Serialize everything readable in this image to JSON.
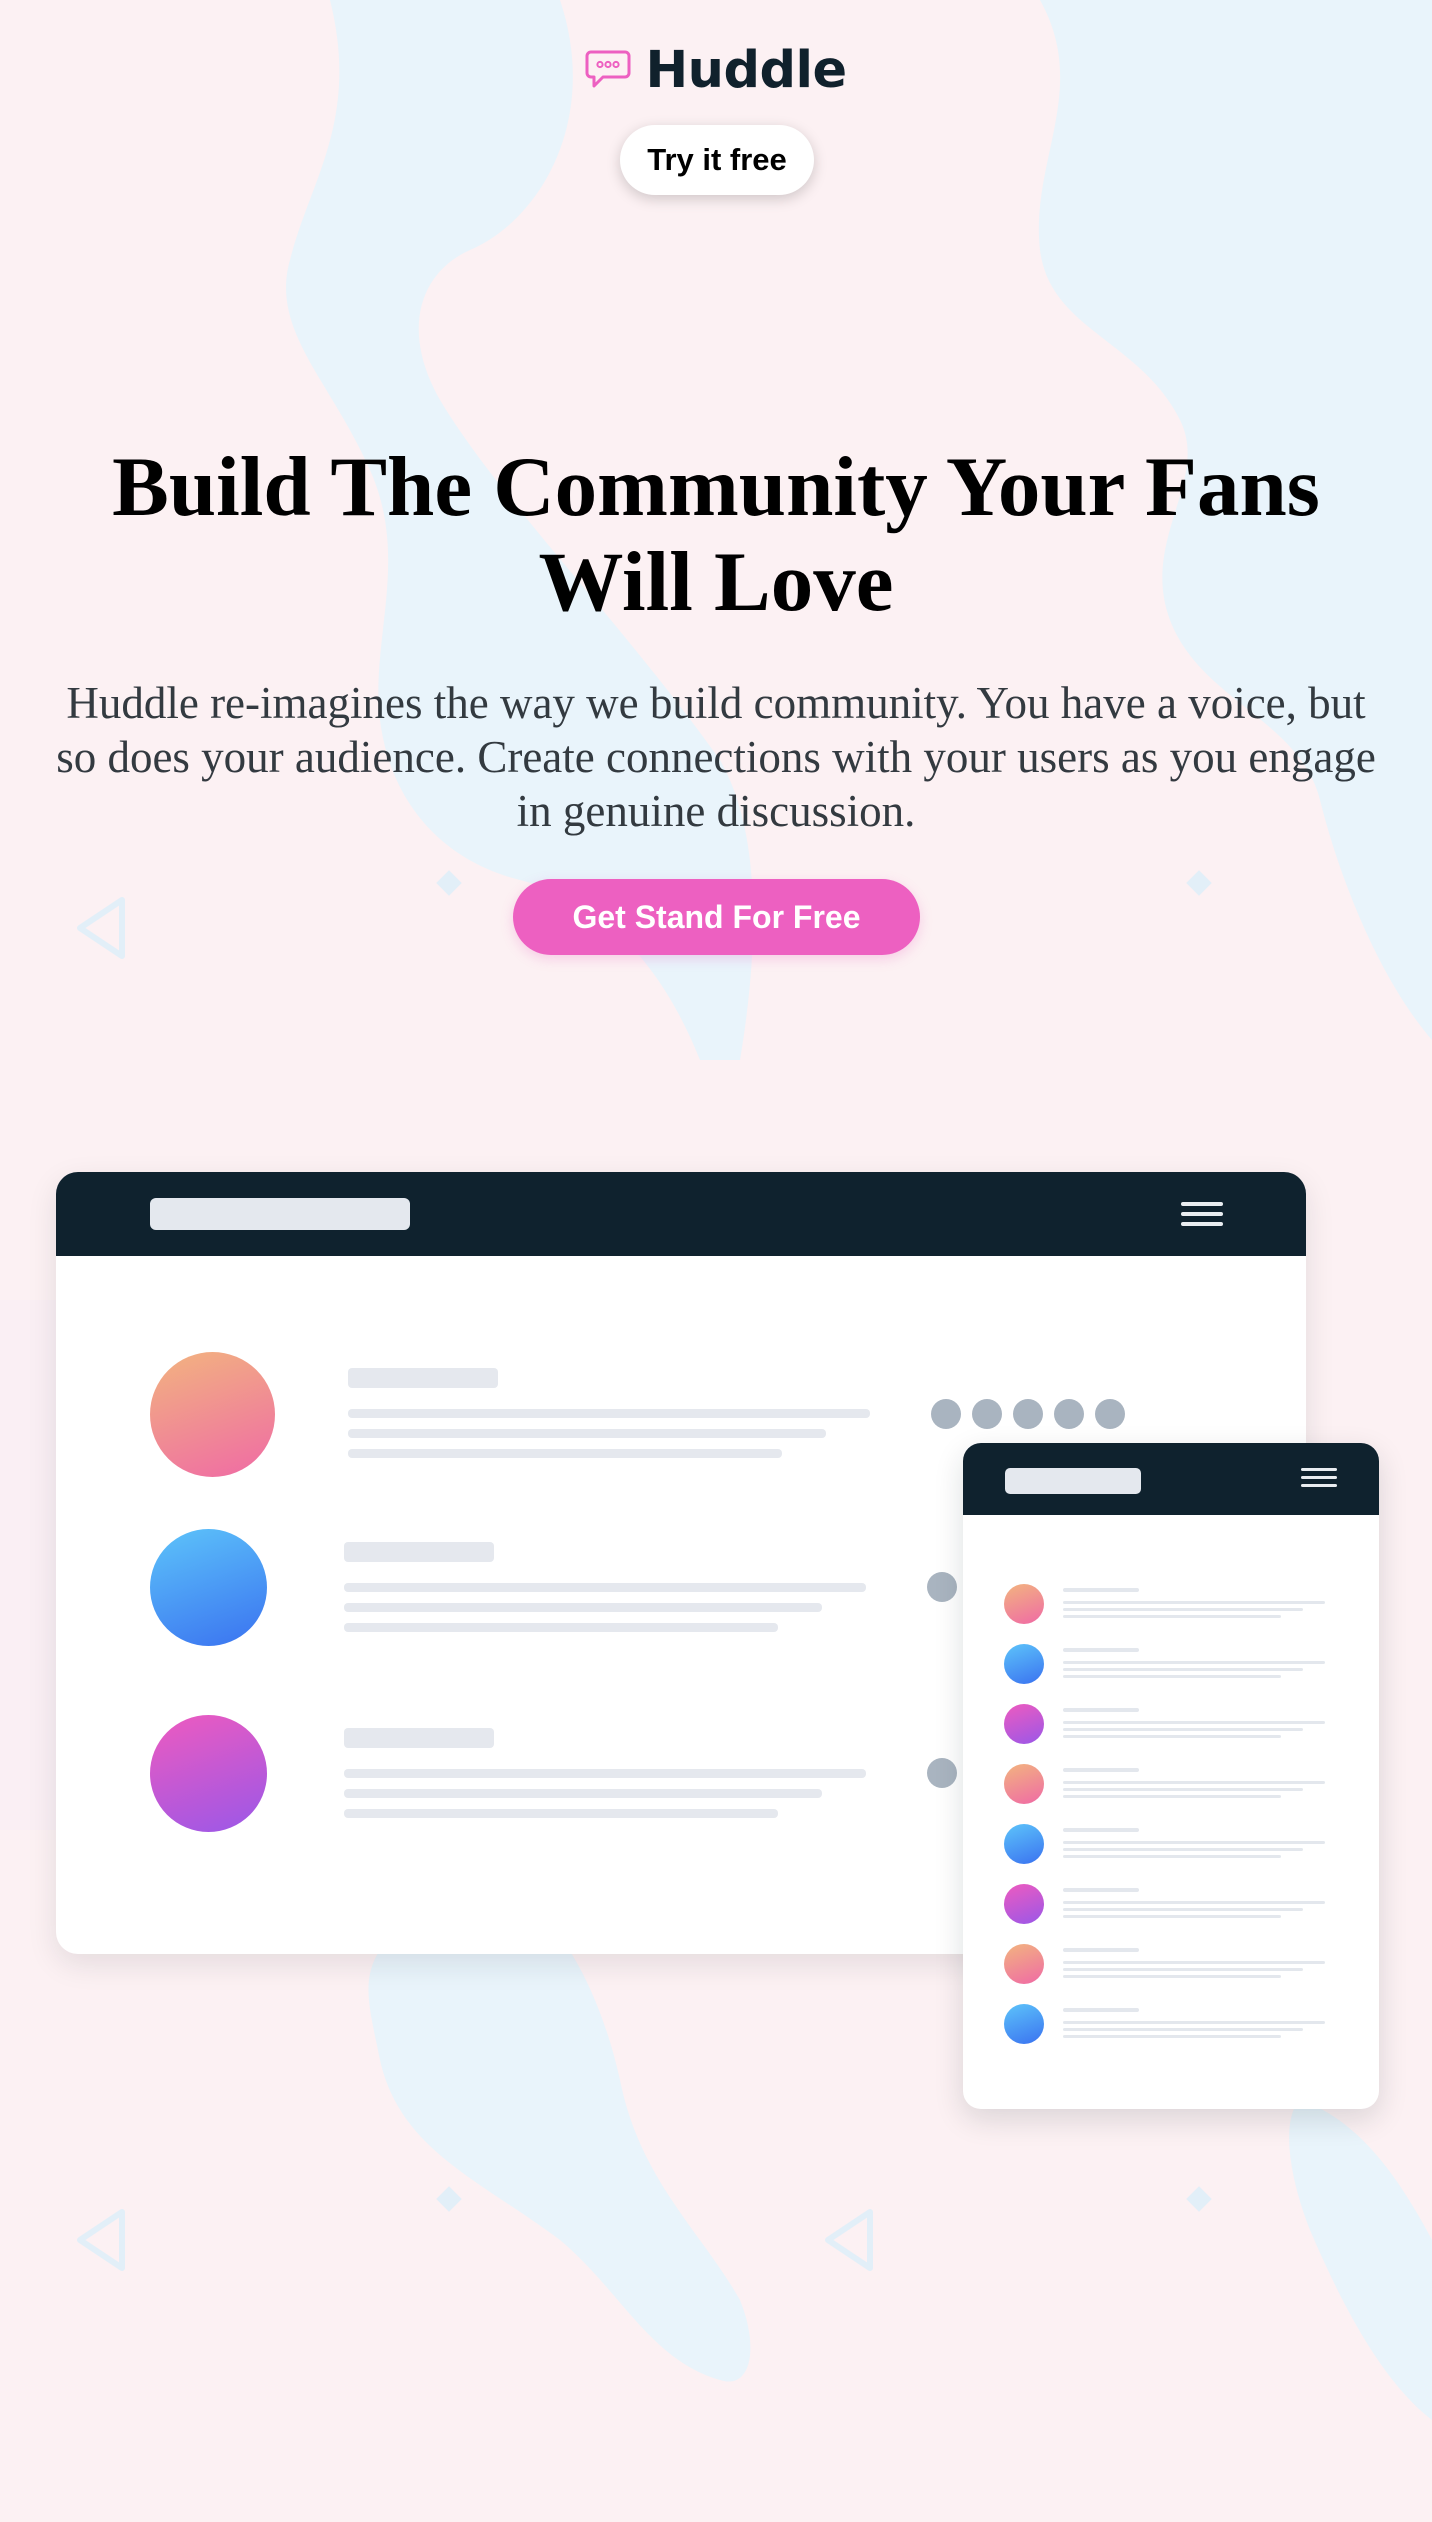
{
  "brand": {
    "name": "Huddle",
    "logo_icon": "chat-bubble-icon",
    "accent": "#ed60c1",
    "dark": "#10212c"
  },
  "header": {
    "try_label": "Try it free"
  },
  "hero": {
    "title": "Build The Community Your Fans Will Love",
    "text": "Huddle re-imagines the way we build community. You have a voice, but so does your audience. Create connections with your users as you engage in genuine discussion.",
    "cta_label": "Get Stand For Free"
  },
  "mockup": {
    "desktop_rows": [
      "orange",
      "blue",
      "purple"
    ],
    "mobile_rows": [
      "orange",
      "blue",
      "purple",
      "orange",
      "blue",
      "purple",
      "orange",
      "blue"
    ]
  },
  "colors": {
    "background": "#fcf1f3",
    "mockup_bar": "#0f222e",
    "gradient_orange": "#f2b47f",
    "gradient_blue": "#5dc4fa",
    "gradient_purple": "#ee5bbf"
  }
}
